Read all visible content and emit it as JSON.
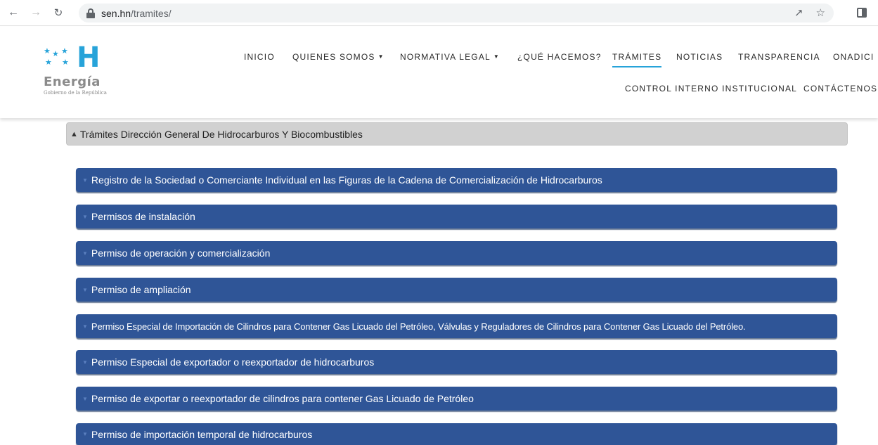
{
  "browser": {
    "url_host": "sen.hn",
    "url_path": "/tramites/",
    "icons": [
      "back-arrow-icon",
      "forward-arrow-icon",
      "reload-icon",
      "lock-icon",
      "share-icon",
      "bookmark-star-icon",
      "side-panel-icon"
    ]
  },
  "logo": {
    "wordmark": "Energía",
    "tagline": "Gobierno de la República",
    "accent_color": "#27a3d9"
  },
  "nav": {
    "row1": [
      {
        "label": "INICIO",
        "dropdown": false,
        "active": false
      },
      {
        "label": "QUIENES SOMOS",
        "dropdown": true,
        "active": false
      },
      {
        "label": "NORMATIVA LEGAL",
        "dropdown": true,
        "active": false
      },
      {
        "label": "¿QUÉ HACEMOS?",
        "dropdown": false,
        "active": false
      },
      {
        "label": "TRÁMITES",
        "dropdown": false,
        "active": true
      },
      {
        "label": "NOTICIAS",
        "dropdown": false,
        "active": false
      },
      {
        "label": "TRANSPARENCIA",
        "dropdown": false,
        "active": false
      },
      {
        "label": "ONADICI",
        "dropdown": false,
        "active": false
      }
    ],
    "row2": [
      {
        "label": "CONTROL INTERNO INSTITUCIONAL"
      },
      {
        "label": "CONTÁCTENOS"
      }
    ]
  },
  "section": {
    "title": "Trámites Dirección General De Hidrocarburos Y Biocombustibles",
    "items": [
      "Registro de la Sociedad o Comerciante Individual en las Figuras de la Cadena de Comercialización de Hidrocarburos",
      "Permisos de instalación",
      "Permiso de operación y comercialización",
      "Permiso de ampliación",
      "Permiso Especial de Importación de Cilindros para Contener Gas Licuado del Petróleo, Válvulas y Reguladores de Cilindros para Contener Gas Licuado del Petróleo.",
      "Permiso Especial de exportador o reexportador de hidrocarburos",
      "Permiso de exportar o reexportador de cilindros para contener Gas Licuado de Petróleo",
      "Permiso de importación temporal de hidrocarburos"
    ],
    "item_color": "#2f5597"
  }
}
